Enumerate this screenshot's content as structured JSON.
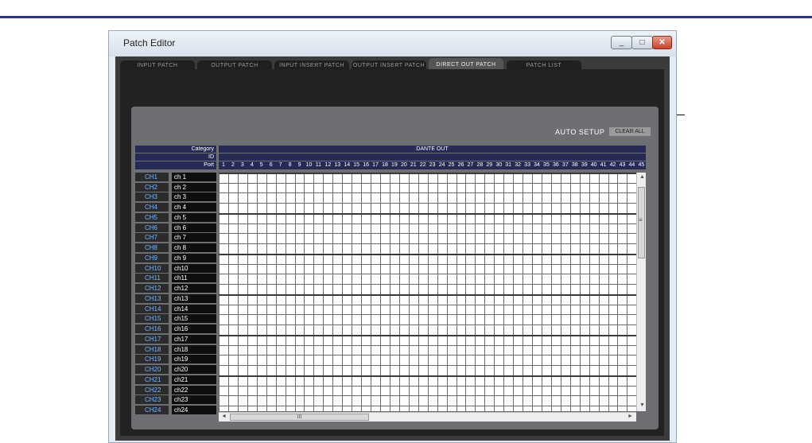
{
  "window": {
    "title": "Patch Editor"
  },
  "tabs": [
    {
      "label": "INPUT PATCH",
      "active": false
    },
    {
      "label": "OUTPUT PATCH",
      "active": false
    },
    {
      "label": "INPUT INSERT PATCH",
      "active": false
    },
    {
      "label": "OUTPUT INSERT PATCH",
      "active": false
    },
    {
      "label": "DIRECT OUT PATCH",
      "active": true
    },
    {
      "label": "PATCH LIST",
      "active": false
    }
  ],
  "toolbar": {
    "auto_setup": "AUTO SETUP",
    "clear_all": "CLEAR ALL"
  },
  "header": {
    "category_label": "Category",
    "id_label": "ID",
    "port_label": "Port",
    "category_value": "DANTE OUT"
  },
  "ports": [
    "1",
    "2",
    "3",
    "4",
    "5",
    "6",
    "7",
    "8",
    "9",
    "10",
    "11",
    "12",
    "13",
    "14",
    "15",
    "16",
    "17",
    "18",
    "19",
    "20",
    "21",
    "22",
    "23",
    "24",
    "25",
    "26",
    "27",
    "28",
    "29",
    "30",
    "31",
    "32",
    "33",
    "34",
    "35",
    "36",
    "37",
    "38",
    "39",
    "40",
    "41",
    "42",
    "43",
    "44",
    "45"
  ],
  "channels": [
    {
      "ch": "CH1",
      "name": "ch 1"
    },
    {
      "ch": "CH2",
      "name": "ch 2"
    },
    {
      "ch": "CH3",
      "name": "ch 3"
    },
    {
      "ch": "CH4",
      "name": "ch 4"
    },
    {
      "ch": "CH5",
      "name": "ch 5"
    },
    {
      "ch": "CH6",
      "name": "ch 6"
    },
    {
      "ch": "CH7",
      "name": "ch 7"
    },
    {
      "ch": "CH8",
      "name": "ch 8"
    },
    {
      "ch": "CH9",
      "name": "ch 9"
    },
    {
      "ch": "CH10",
      "name": "ch10"
    },
    {
      "ch": "CH11",
      "name": "ch11"
    },
    {
      "ch": "CH12",
      "name": "ch12"
    },
    {
      "ch": "CH13",
      "name": "ch13"
    },
    {
      "ch": "CH14",
      "name": "ch14"
    },
    {
      "ch": "CH15",
      "name": "ch15"
    },
    {
      "ch": "CH16",
      "name": "ch16"
    },
    {
      "ch": "CH17",
      "name": "ch17"
    },
    {
      "ch": "CH18",
      "name": "ch18"
    },
    {
      "ch": "CH19",
      "name": "ch19"
    },
    {
      "ch": "CH20",
      "name": "ch20"
    },
    {
      "ch": "CH21",
      "name": "ch21"
    },
    {
      "ch": "CH22",
      "name": "ch22"
    },
    {
      "ch": "CH23",
      "name": "ch23"
    },
    {
      "ch": "CH24",
      "name": "ch24"
    }
  ],
  "scrollbars": {
    "h_thumb_text": "III",
    "v_thumb_text": "≡"
  }
}
